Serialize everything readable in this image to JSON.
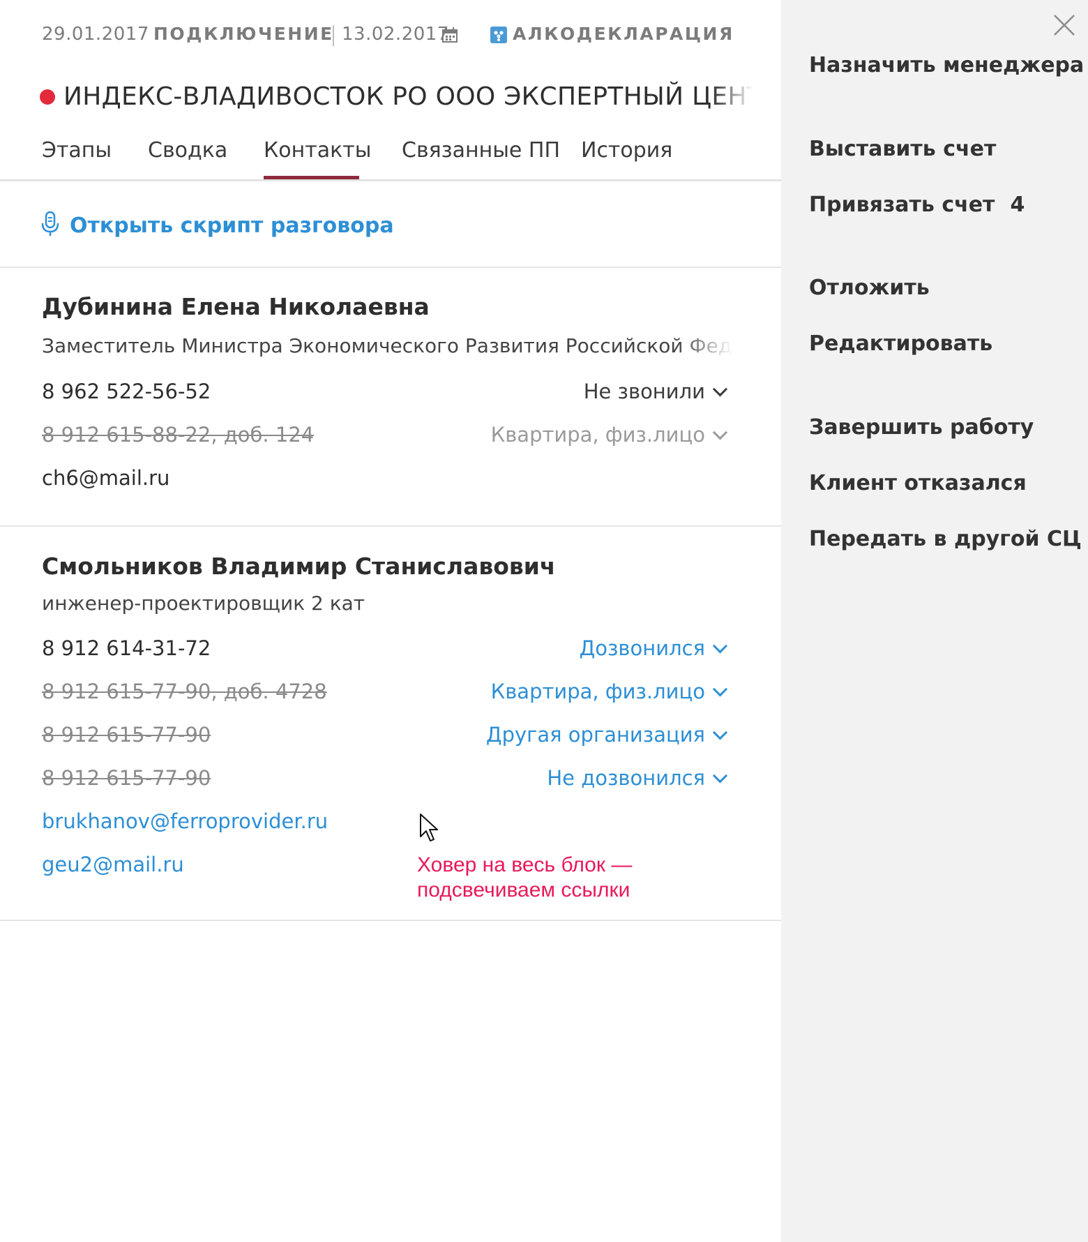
{
  "header": {
    "date": "29.01.2017",
    "stage": "ПОДКЛЮЧЕНИЕ",
    "stage_date": "13.02.2017",
    "product": "АЛКОДЕКЛАРАЦИЯ",
    "title": "ИНДЕКС-ВЛАДИВОСТОК РО ООО ЭКСПЕРТНЫЙ ЦЕНТР ИНДЕКС",
    "status_color": "#e32a3b"
  },
  "tabs": [
    {
      "label": "Этапы"
    },
    {
      "label": "Сводка"
    },
    {
      "label": "Контакты",
      "active": true
    },
    {
      "label": "Связанные ПП"
    },
    {
      "label": "История"
    }
  ],
  "script_link": "Открыть скрипт разговора",
  "contacts": [
    {
      "name": "Дубинина Елена Николаевна",
      "role": "Заместитель Министра Экономического Развития Российской Федерации",
      "phones": [
        {
          "number": "8 962 522-56-52",
          "status": "Не звонили"
        },
        {
          "number": "8 912 615-88-22, доб. 124",
          "status": "Квартира, физ.лицо"
        }
      ],
      "emails": [
        "ch6@mail.ru"
      ]
    },
    {
      "name": "Смольников Владимир Станиславович",
      "role": "инженер-проектировщик 2 кат",
      "phones": [
        {
          "number": "8 912 614-31-72",
          "status": "Дозвонился"
        },
        {
          "number": "8 912 615-77-90, доб. 4728",
          "status": "Квартира, физ.лицо"
        },
        {
          "number": "8 912 615-77-90",
          "status": "Другая организация"
        },
        {
          "number": "8 912 615-77-90",
          "status": "Не дозвонился"
        }
      ],
      "emails": [
        "brukhanov@ferroprovider.ru",
        "geu2@mail.ru"
      ]
    }
  ],
  "annotation": {
    "line1": "Ховер на весь блок —",
    "line2": "подсвечиваем ссылки"
  },
  "sidebar": {
    "assign_manager": "Назначить менеджера",
    "issue_invoice": "Выставить счет",
    "link_invoice": "Привязать счет",
    "link_invoice_count": "4",
    "postpone": "Отложить",
    "edit": "Редактировать",
    "finish": "Завершить работу",
    "client_refused": "Клиент отказался",
    "transfer": "Передать в другой СЦ"
  },
  "colors": {
    "accent_link": "#2d8fd5",
    "tab_underline": "#8e2c3d",
    "annotation": "#e8195a",
    "sidebar_bg": "#f2f2f2"
  }
}
